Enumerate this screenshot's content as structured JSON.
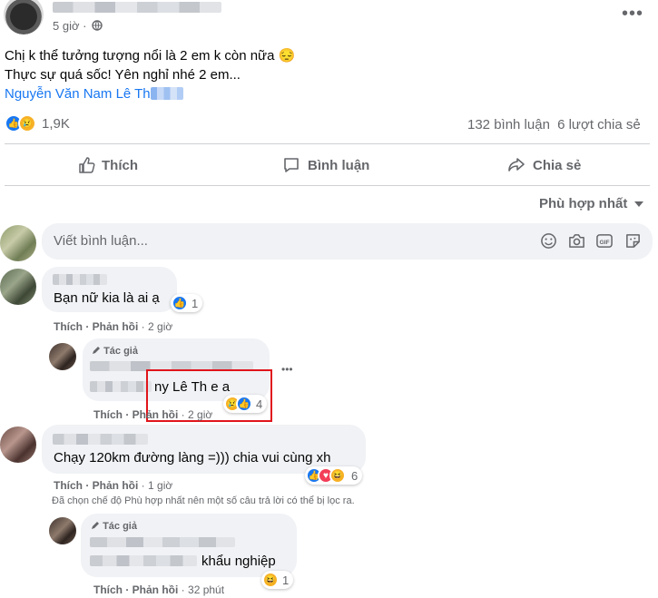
{
  "post": {
    "time": "5 giờ ·",
    "privacy_icon": "globe-icon",
    "more_icon": "more-dots-icon",
    "line1": "Chị k thể tưởng tượng nổi là 2 em k còn nữa 😔",
    "line2": "Thực sự quá sốc! Yên nghỉ nhé 2 em...",
    "tag": "Nguyễn Văn Nam Lê Th",
    "reaction_count": "1,9K",
    "comments": "132 bình luận",
    "shares": "6 lượt chia sẻ"
  },
  "actions": {
    "like": "Thích",
    "comment": "Bình luận",
    "share": "Chia sẻ"
  },
  "sort": {
    "label": "Phù hợp nhất"
  },
  "composer": {
    "placeholder": "Viết bình luận..."
  },
  "comments": [
    {
      "text": "Bạn nữ kia là ai ạ",
      "reactions": "1",
      "like": "Thích",
      "reply": "Phản hồi",
      "time": "2 giờ"
    },
    {
      "author_badge": "Tác giả",
      "text": "ny Lê Th  e a",
      "reactions": "4",
      "like": "Thích",
      "reply": "Phản hồi",
      "time": "2 giờ"
    },
    {
      "text": "Chạy 120km đường làng =))) chia vui cùng xh",
      "reactions": "6",
      "like": "Thích",
      "reply": "Phản hồi",
      "time": "1 giờ"
    },
    {
      "author_badge": "Tác giả",
      "text": "khẩu nghiệp",
      "reactions": "1",
      "like": "Thích",
      "reply": "Phản hồi",
      "time": "32 phút"
    }
  ],
  "filter_note": "Đã chọn chế độ Phù hợp nhất nên một số câu trả lời có thể bị lọc ra.",
  "highlight_color": "#e0151b",
  "brand_color": "#1877f2"
}
